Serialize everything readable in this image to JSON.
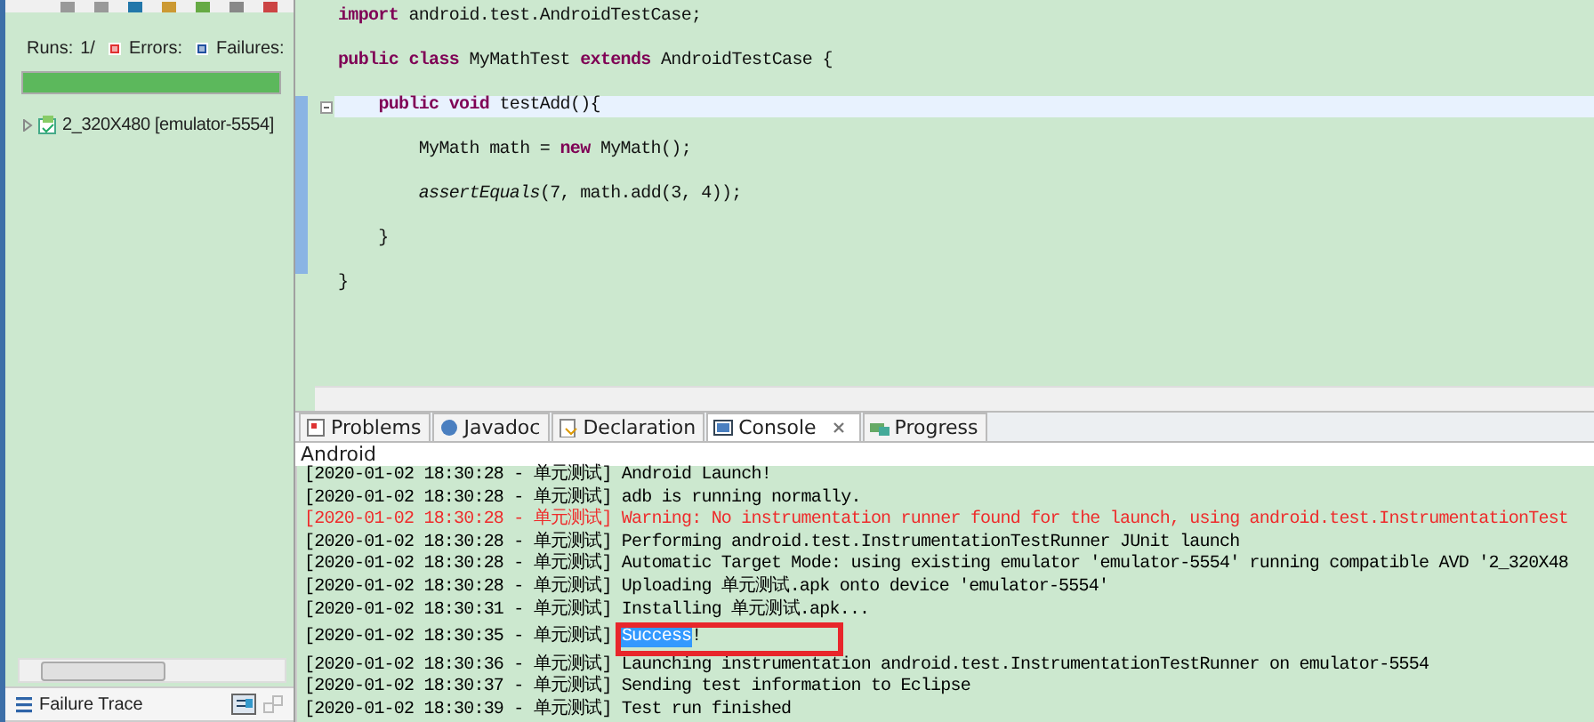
{
  "junit": {
    "counters": [
      {
        "kind": "runs",
        "label": "Runs:",
        "value": "1/"
      },
      {
        "kind": "errors",
        "label": "Errors:"
      },
      {
        "kind": "failures",
        "label": "Failures:"
      }
    ],
    "progress": {
      "level": 1
    },
    "tree": [
      {
        "label": "2_320X480 [emulator-5554]",
        "expanded": false
      }
    ],
    "failure_trace": {
      "title": "Failure Trace"
    }
  },
  "editor": {
    "lines": [
      {
        "text": "**import** android.test.AndroidTestCase;",
        "current": false,
        "in_range": false,
        "foldable": false
      },
      {
        "text": "**public** **class** MyMathTest **extends** AndroidTestCase {",
        "current": false,
        "in_range": false,
        "foldable": false
      },
      {
        "text": "    **public** **void** testAdd(){",
        "current": true,
        "in_range": true,
        "foldable": true
      },
      {
        "text": "        MyMath math = **new** MyMath();",
        "current": false,
        "in_range": true,
        "foldable": false
      },
      {
        "text": "        *assertEquals*(7, math.add(3, 4));",
        "current": false,
        "in_range": true,
        "foldable": false
      },
      {
        "text": "    }",
        "current": false,
        "in_range": true,
        "foldable": false
      },
      {
        "text": "}",
        "current": false,
        "in_range": false,
        "foldable": false
      }
    ]
  },
  "tabs": [
    {
      "label": "Problems",
      "selected": false
    },
    {
      "label": "Javadoc",
      "selected": false
    },
    {
      "label": "Declaration",
      "selected": false
    },
    {
      "label": "Console",
      "selected": true
    },
    {
      "label": "Progress",
      "selected": false
    }
  ],
  "console": {
    "title": "Android",
    "lines": [
      {
        "text": "[2020-01-02 18:30:28 - 单元测试] Android Launch!",
        "kind": "info"
      },
      {
        "text": "[2020-01-02 18:30:28 - 单元测试] adb is running normally.",
        "kind": "info"
      },
      {
        "text": "[2020-01-02 18:30:28 - 单元测试] Warning: No instrumentation runner found for the launch, using android.test.InstrumentationTest",
        "kind": "error"
      },
      {
        "text": "[2020-01-02 18:30:28 - 单元测试] Performing android.test.InstrumentationTestRunner JUnit launch",
        "kind": "info"
      },
      {
        "text": "[2020-01-02 18:30:28 - 单元测试] Automatic Target Mode: using existing emulator 'emulator-5554' running compatible AVD '2_320X48",
        "kind": "info"
      },
      {
        "text": "[2020-01-02 18:30:28 - 单元测试] Uploading 单元测试.apk onto device 'emulator-5554'",
        "kind": "info"
      },
      {
        "text": "[2020-01-02 18:30:31 - 单元测试] Installing 单元测试.apk...",
        "kind": "info"
      },
      {
        "kind": "info",
        "framed": true,
        "parts": [
          {
            "text": "[2020-01-02 18:30:35 - 单元测试] ",
            "selected": false
          },
          {
            "text": "Success",
            "selected": true
          },
          {
            "text": "!",
            "selected": false
          }
        ]
      },
      {
        "text": "[2020-01-02 18:30:36 - 单元测试] Launching instrumentation android.test.InstrumentationTestRunner on emulator-5554",
        "kind": "info"
      },
      {
        "text": "[2020-01-02 18:30:37 - 单元测试] Sending test information to Eclipse",
        "kind": "info"
      },
      {
        "text": "[2020-01-02 18:30:39 - 单元测试] Test run finished",
        "kind": "info"
      }
    ],
    "annotation": {
      "kind": "rectangle"
    }
  }
}
